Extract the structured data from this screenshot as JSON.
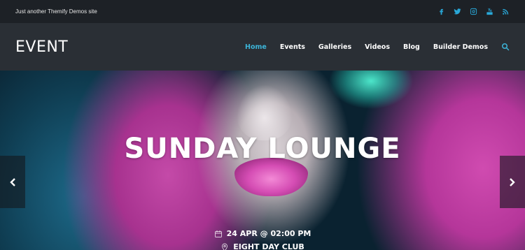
{
  "topbar": {
    "tagline": "Just another Themify Demos site",
    "social": [
      "facebook-icon",
      "twitter-icon",
      "instagram-icon",
      "youtube-icon",
      "rss-icon"
    ],
    "icon_color": "#29a8d8"
  },
  "header": {
    "logo": "EVENT",
    "nav": [
      {
        "label": "Home",
        "active": true
      },
      {
        "label": "Events",
        "active": false
      },
      {
        "label": "Galleries",
        "active": false
      },
      {
        "label": "Videos",
        "active": false
      },
      {
        "label": "Blog",
        "active": false
      },
      {
        "label": "Builder Demos",
        "active": false
      }
    ],
    "accent": "#3cb4d8"
  },
  "hero": {
    "title": "SUNDAY LOUNGE",
    "date": "24 APR @ 02:00 PM",
    "location": "EIGHT DAY CLUB"
  }
}
